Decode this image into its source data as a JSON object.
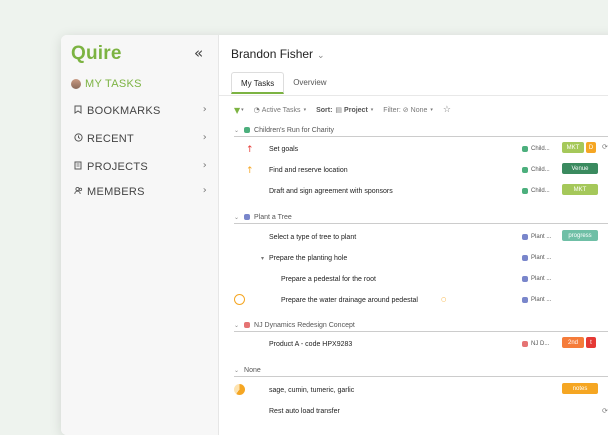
{
  "app": {
    "logo": "Quire",
    "collapse_icon": "«"
  },
  "sidebar": {
    "items": [
      {
        "label": "MY TASKS",
        "icon": "avatar"
      },
      {
        "label": "BOOKMARKS",
        "icon": "bookmark-icon"
      },
      {
        "label": "RECENT",
        "icon": "clock-icon"
      },
      {
        "label": "PROJECTS",
        "icon": "projects-icon"
      },
      {
        "label": "MEMBERS",
        "icon": "members-icon"
      }
    ]
  },
  "header": {
    "user": "Brandon Fisher"
  },
  "tabs": [
    {
      "label": "My Tasks"
    },
    {
      "label": "Overview"
    }
  ],
  "toolbar": {
    "status": "Active Tasks",
    "sort_label": "Sort:",
    "sort_value": "Project",
    "filter_label": "Filter:",
    "filter_value": "None"
  },
  "groups": [
    {
      "name": "Children's Run for Charity",
      "color": "#4caf7d"
    },
    {
      "name": "Plant a Tree",
      "color": "#7986cb"
    },
    {
      "name": "NJ Dynamics Redesign Concept",
      "color": "#e57373"
    },
    {
      "name": "None",
      "color": ""
    }
  ],
  "tasks": [
    {
      "title": "Set goals",
      "project": "Child...",
      "project_color": "#4caf7d",
      "tags": [
        {
          "label": "MKT",
          "color": "#a5c85a"
        },
        {
          "label": "D",
          "color": "#f5a623"
        }
      ]
    },
    {
      "title": "Find and reserve location",
      "project": "Child...",
      "project_color": "#4caf7d",
      "tags": [
        {
          "label": "Venue",
          "color": "#3a8a5f"
        }
      ]
    },
    {
      "title": "Draft and sign agreement with sponsors",
      "project": "Child...",
      "project_color": "#4caf7d",
      "tags": [
        {
          "label": "MKT",
          "color": "#a5c85a"
        }
      ]
    },
    {
      "title": "Select a type of tree to plant",
      "project": "Plant ...",
      "project_color": "#7986cb",
      "tags": [
        {
          "label": "progress",
          "color": "#6fbfa6"
        }
      ]
    },
    {
      "title": "Prepare the planting hole",
      "project": "Plant ...",
      "project_color": "#7986cb",
      "tags": []
    },
    {
      "title": "Prepare a pedestal for the root",
      "project": "Plant ...",
      "project_color": "#7986cb",
      "tags": []
    },
    {
      "title": "Prepare the water drainage around pedestal",
      "project": "Plant ...",
      "project_color": "#7986cb",
      "tags": []
    },
    {
      "title": "Product A - code HPX9283",
      "project": "NJ D...",
      "project_color": "#e57373",
      "tags": [
        {
          "label": "2nd",
          "color": "#f57c3a"
        },
        {
          "label": "t",
          "color": "#e53935"
        }
      ]
    },
    {
      "title": "sage, cumin, tumeric, garlic",
      "project": "",
      "project_color": "",
      "tags": [
        {
          "label": "notes",
          "color": "#f5a623"
        }
      ]
    },
    {
      "title": "Rest auto load transfer",
      "project": "",
      "project_color": "",
      "tags": []
    }
  ],
  "colors": {
    "accent": "#7cb342",
    "priority_high": "#e53935",
    "priority_medium": "#f5a623"
  }
}
